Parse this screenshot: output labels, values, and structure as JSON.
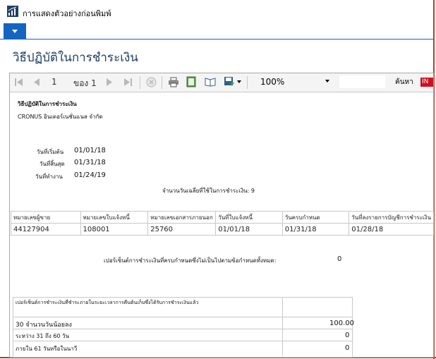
{
  "window": {
    "title": "การแสดงตัวอย่างก่อนพิมพ์"
  },
  "page": {
    "heading": "วิธีปฏิบัติในการชำระเงิน"
  },
  "toolbar": {
    "current_page": "1",
    "of_pages": "ของ 1",
    "zoom": "100%",
    "find_label": "ค้นหา",
    "indicator": "IN"
  },
  "report": {
    "title": "วิธีปฏิบัติในการชำระเงิน",
    "company": "CRONUS อินเตอร์เนชั่นแนล จำกัด",
    "dates": [
      {
        "label": "วันที่เริ่มต้น",
        "value": "01/01/18"
      },
      {
        "label": "วันที่สิ้นสุด",
        "value": "01/31/18"
      },
      {
        "label": "วันที่ทำงาน",
        "value": "01/24/19"
      }
    ],
    "count_text": "จำนวนวันเฉลี่ยที่ใช้ในการชำระเงิน: 9",
    "table": {
      "headers": [
        "หมายเลขผู้ขาย",
        "หมายเลขใบแจ้งหนี้",
        "หมายเลขเอกสารภายนอก",
        "วันที่ใบแจ้งหนี้",
        "วันครบกำหนด",
        "วันที่ลงรายการบัญชีการชำระเงิน"
      ],
      "rows": [
        [
          "44127904",
          "108001",
          "25760",
          "01/01/18",
          "01/31/18",
          "01/28/18"
        ]
      ]
    },
    "overdue_text": "เปอร์เซ็นต์การชำระเงินที่ครบกำหนดซึ่งไม่เป็นไปตามข้อกำหนดทั้งหมด:",
    "overdue_value": "0",
    "summary": {
      "header": "เปอร์เซ็นต์การชำระเงินที่ชำระภายในระยะเวลาการคืนต้นเก็บซึ่งได้รับการชำระเงินแล้ว",
      "rows": [
        {
          "label": "30 จำนวนวันน้อยลง",
          "value": "100.00"
        },
        {
          "label": "ระหว่าง 31 ถึง 60 วัน",
          "value": "0"
        },
        {
          "label": "ภายใน 61 วันหรือในนาวี",
          "value": "0"
        }
      ]
    }
  }
}
